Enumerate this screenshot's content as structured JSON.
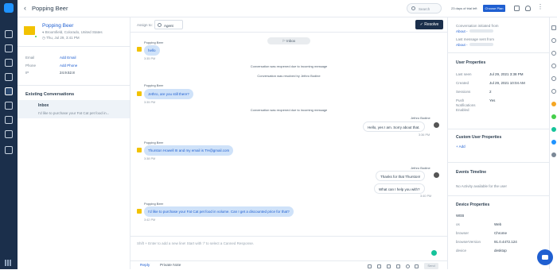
{
  "header": {
    "title": "Popping Beer",
    "search_placeholder": "Search",
    "trial_text": "23 days of trial left",
    "choose_plan": "Choose Plan"
  },
  "contact": {
    "name": "Popping Beer",
    "location": "Broomfield, Colorado, United States",
    "date": "Thu, Jul 29, 3:41 PM",
    "email_label": "Email",
    "email_value": "Add Email",
    "phone_label": "Phone",
    "phone_value": "Add Phone",
    "ip_label": "IP",
    "ip_value": "24.9.52.8"
  },
  "existing": {
    "title": "Existing Conversations",
    "item_title": "Inbox",
    "item_snippet": "I'd like to purchase your Fat Cat pet food in..."
  },
  "conversation": {
    "assign_label": "Assign to:",
    "agent_label": "Agent",
    "resolve_label": "Resolve",
    "inbox_pill": "Inbox",
    "messages": [
      {
        "sender": "Popping Beer",
        "text": "hello",
        "time": "3:35 PM"
      },
      {
        "system": "Conversation was reopened due to incoming message"
      },
      {
        "system": "Conversation was resolved by Jethro Bodine"
      },
      {
        "sender": "Popping Beer",
        "text": "Jethro, are you still there?",
        "time": "3:35 PM"
      },
      {
        "system": "Conversation was reopened due to incoming message"
      },
      {
        "sender": "Jethro Bodine",
        "text": "Hello, yes I am. Sorry about that.",
        "time": "3:36 PM"
      },
      {
        "sender": "Popping Beer",
        "text": "Thurston Howell III and my email is TH@gmail.com",
        "time": "3:38 PM"
      },
      {
        "sender": "Jethro Bodine",
        "text": "Thanks for that Thurston!",
        "time": ""
      },
      {
        "text": "What can I help you with?",
        "time": "3:40 PM"
      },
      {
        "sender": "Popping Beer",
        "text": "I'd like to purchase your Fat Cat pet food in volume. Can I get a discounted price for that?",
        "time": "3:42 PM"
      }
    ],
    "composer_placeholder": "Shift + Enter to add a new line! Start with '/' to select a Canned Response.",
    "tab_reply": "Reply",
    "tab_private": "Private Note",
    "send_label": "Send"
  },
  "right": {
    "initiated_label": "Conversation initiated from",
    "initiated_link": "About -",
    "last_message_label": "Last message sent from",
    "last_message_link": "About -",
    "user_props_title": "User Properties",
    "last_seen_label": "Last seen",
    "last_seen_value": "Jul 29, 2021 3:38 PM",
    "created_label": "Created",
    "created_value": "Jul 29, 2021 10:04 AM",
    "sessions_label": "Sessions",
    "sessions_value": "2",
    "push_label_1": "Push",
    "push_label_2": "Notifications",
    "push_label_3": "Enabled",
    "push_value": "Yes",
    "custom_props_title": "Custom User Properties",
    "add_label": "+ Add",
    "events_title": "Events Timeline",
    "events_empty": "No Activity available for the user",
    "device_title": "Device Properties",
    "device_web": "WEB",
    "os_label": "os",
    "os_value": "Web",
    "browser_label": "browser",
    "browser_value": "Chrome",
    "browser_version_label": "browserVersion",
    "browser_version_value": "91.0.4472.124",
    "device_label": "device",
    "device_value": "desktop"
  }
}
